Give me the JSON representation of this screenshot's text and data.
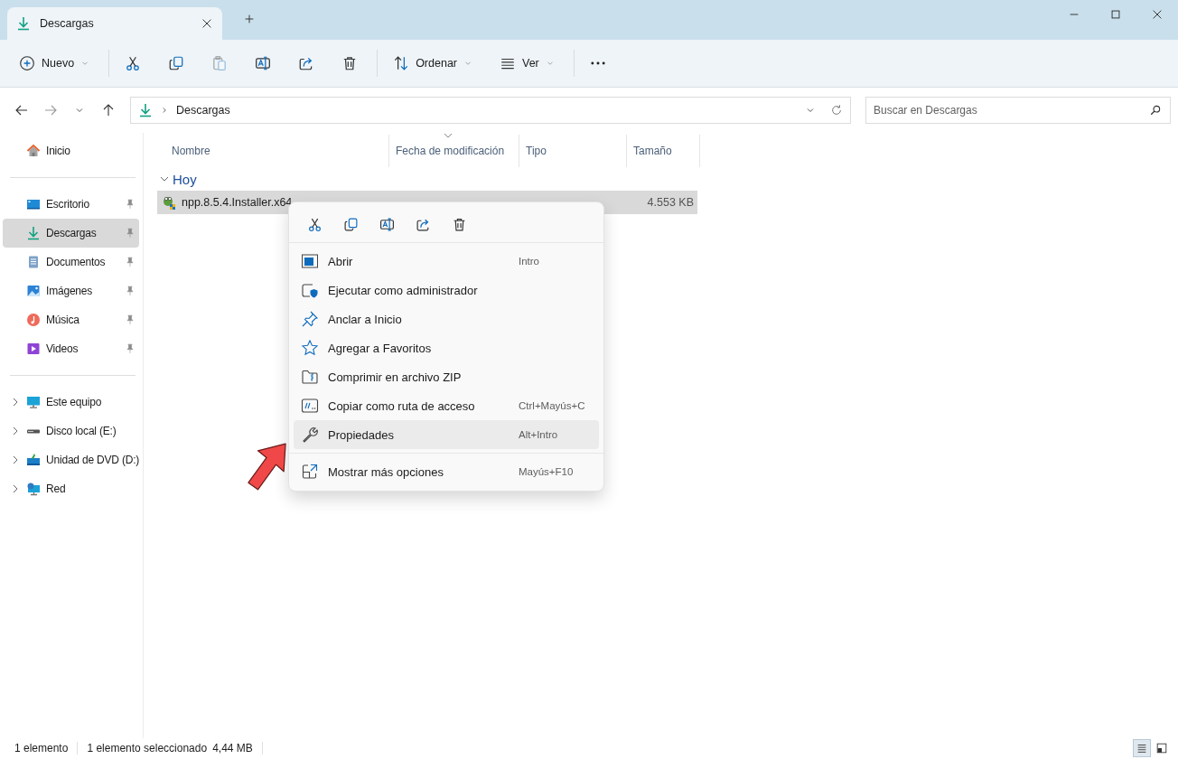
{
  "window": {
    "tab_title": "Descargas"
  },
  "toolbar": {
    "items": [
      {
        "kind": "new",
        "label": "Nuevo",
        "disabled": false
      },
      {
        "kind": "cut",
        "disabled": false
      },
      {
        "kind": "copy",
        "disabled": false
      },
      {
        "kind": "paste",
        "disabled": true
      },
      {
        "kind": "rename",
        "disabled": false
      },
      {
        "kind": "share",
        "disabled": false
      },
      {
        "kind": "delete",
        "disabled": false
      },
      {
        "kind": "sort",
        "label": "Ordenar",
        "disabled": false
      },
      {
        "kind": "view",
        "label": "Ver",
        "disabled": false
      },
      {
        "kind": "more",
        "disabled": false
      }
    ]
  },
  "address": {
    "path": [
      "Descargas"
    ]
  },
  "search": {
    "placeholder": "Buscar en Descargas"
  },
  "sidebar": {
    "groups": [
      [
        {
          "kind": "home",
          "label": "Inicio",
          "pinned": false,
          "selected": false,
          "expandable": false
        }
      ],
      [
        {
          "kind": "desktop",
          "label": "Escritorio",
          "pinned": true,
          "selected": false,
          "expandable": false
        },
        {
          "kind": "download",
          "label": "Descargas",
          "pinned": true,
          "selected": true,
          "expandable": false
        },
        {
          "kind": "documents",
          "label": "Documentos",
          "pinned": true,
          "selected": false,
          "expandable": false
        },
        {
          "kind": "pictures",
          "label": "Imágenes",
          "pinned": true,
          "selected": false,
          "expandable": false
        },
        {
          "kind": "music",
          "label": "Música",
          "pinned": true,
          "selected": false,
          "expandable": false
        },
        {
          "kind": "videos",
          "label": "Videos",
          "pinned": true,
          "selected": false,
          "expandable": false
        }
      ],
      [
        {
          "kind": "pc",
          "label": "Este equipo",
          "pinned": false,
          "selected": false,
          "expandable": true
        },
        {
          "kind": "drive",
          "label": "Disco local (E:)",
          "pinned": false,
          "selected": false,
          "expandable": true
        },
        {
          "kind": "dvd",
          "label": "Unidad de DVD (D:)",
          "pinned": false,
          "selected": false,
          "expandable": true
        },
        {
          "kind": "network",
          "label": "Red",
          "pinned": false,
          "selected": false,
          "expandable": true
        }
      ]
    ]
  },
  "columns": [
    {
      "label": "Nombre",
      "sorted": false
    },
    {
      "label": "Fecha de modificación",
      "sorted": true
    },
    {
      "label": "Tipo",
      "sorted": false
    },
    {
      "label": "Tamaño",
      "sorted": false
    }
  ],
  "groups": [
    {
      "label": "Hoy",
      "expanded": true,
      "files": [
        {
          "name": "npp.8.5.4.Installer.x64",
          "size": "4.553 KB",
          "selected": true
        }
      ]
    }
  ],
  "context_menu": {
    "actions": [
      {
        "kind": "cut"
      },
      {
        "kind": "copy"
      },
      {
        "kind": "rename"
      },
      {
        "kind": "share"
      },
      {
        "kind": "delete"
      }
    ],
    "sections": [
      [
        {
          "kind": "open",
          "label": "Abrir",
          "shortcut": "Intro",
          "selected": false
        },
        {
          "kind": "admin",
          "label": "Ejecutar como administrador",
          "selected": false
        },
        {
          "kind": "pin",
          "label": "Anclar a Inicio",
          "selected": false
        },
        {
          "kind": "star",
          "label": "Agregar a Favoritos",
          "selected": false
        },
        {
          "kind": "zip",
          "label": "Comprimir en archivo ZIP",
          "selected": false
        },
        {
          "kind": "path",
          "label": "Copiar como ruta de acceso",
          "shortcut": "Ctrl+Mayús+C",
          "selected": false
        },
        {
          "kind": "wrench",
          "label": "Propiedades",
          "shortcut": "Alt+Intro",
          "selected": true
        }
      ],
      [
        {
          "kind": "more",
          "label": "Mostrar más opciones",
          "shortcut": "Mayús+F10",
          "selected": false
        }
      ]
    ]
  },
  "status_bar": {
    "count": "1 elemento",
    "selection": "1 elemento seleccionado",
    "size": "4,44 MB",
    "views": [
      {
        "kind": "details",
        "selected": true
      },
      {
        "kind": "tiles",
        "selected": false
      }
    ]
  }
}
